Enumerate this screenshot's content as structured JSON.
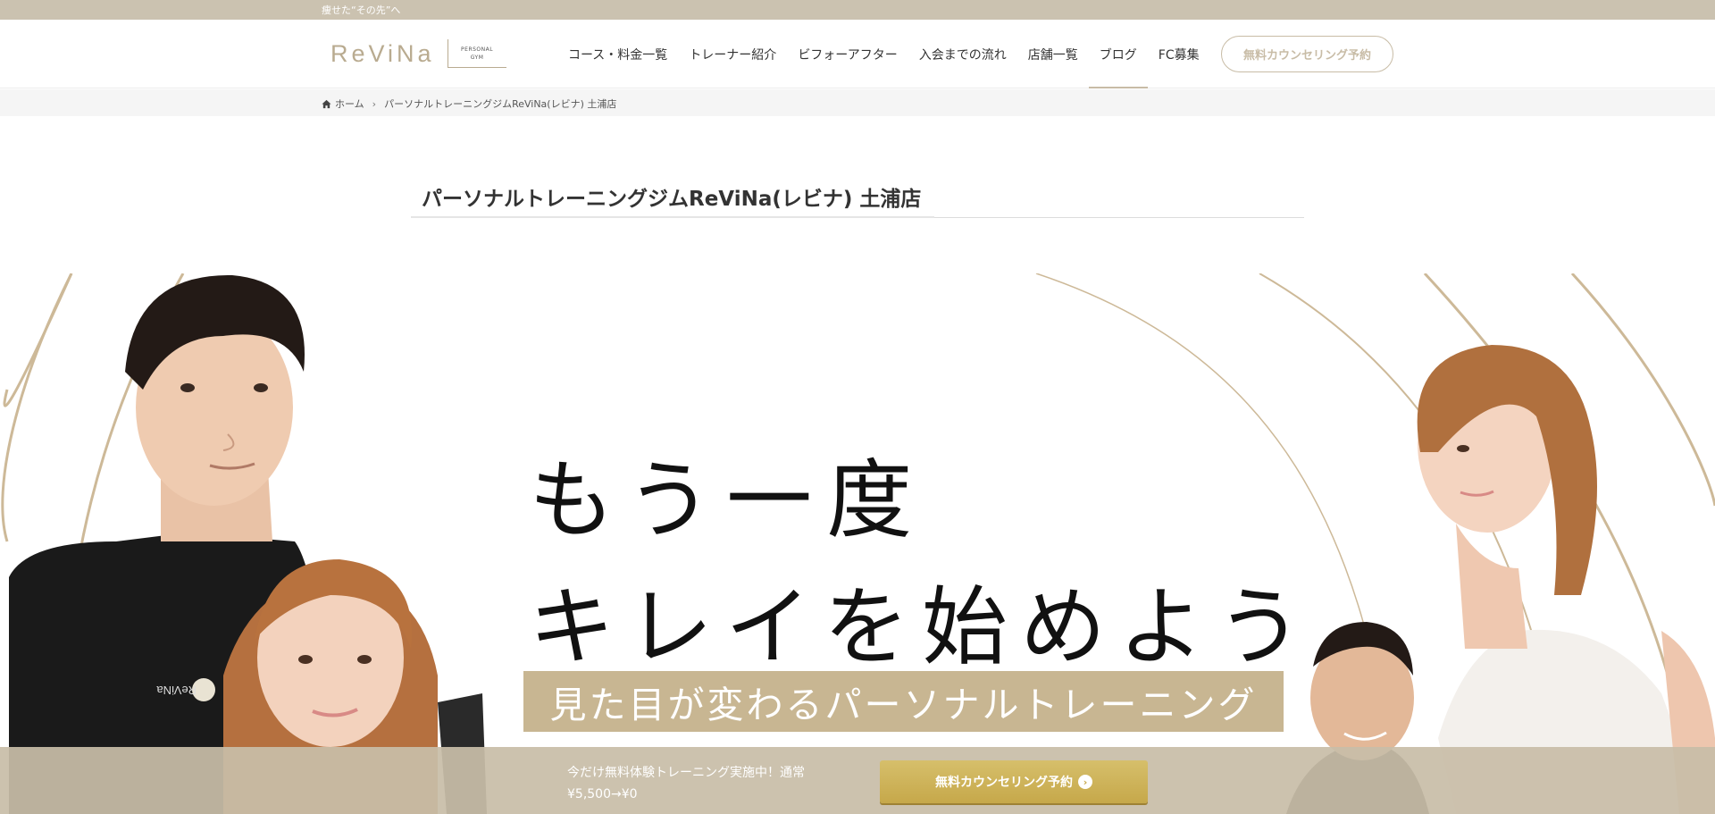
{
  "topbar": {
    "tagline": "痩せた“その先”へ"
  },
  "header": {
    "logo": {
      "word": "ReViNa",
      "sub1": "PERSONAL",
      "sub2": "GYM"
    },
    "nav": [
      {
        "label": "コース・料金一覧"
      },
      {
        "label": "トレーナー紹介"
      },
      {
        "label": "ビフォーアフター"
      },
      {
        "label": "入会までの流れ"
      },
      {
        "label": "店舗一覧"
      },
      {
        "label": "ブログ",
        "active": true
      },
      {
        "label": "FC募集"
      }
    ],
    "cta_label": "無料カウンセリング予約"
  },
  "breadcrumb": {
    "home": "ホーム",
    "current": "パーソナルトレーニングジムReViNa(レビナ) 土浦店"
  },
  "page": {
    "title": "パーソナルトレーニングジムReViNa(レビナ) 土浦店"
  },
  "hero": {
    "headline1": "もう一度",
    "headline2": "キレイを始めよう",
    "subband": "見た目が変わるパーソナルトレーニング",
    "shirt_logo": "ReViNa"
  },
  "bottom": {
    "promo_line1": "今だけ無料体験トレーニング実施中！通常",
    "promo_line2": "¥5,500→¥0",
    "cta_label": "無料カウンセリング予約"
  },
  "colors": {
    "brand": "#b9ab90",
    "topbar": "#cbc2b0",
    "gold_button": "#c6a84a",
    "subband": "#c8b692"
  },
  "icons": [
    "home-icon",
    "chevron-right-icon",
    "arrow-circle-right-icon"
  ]
}
